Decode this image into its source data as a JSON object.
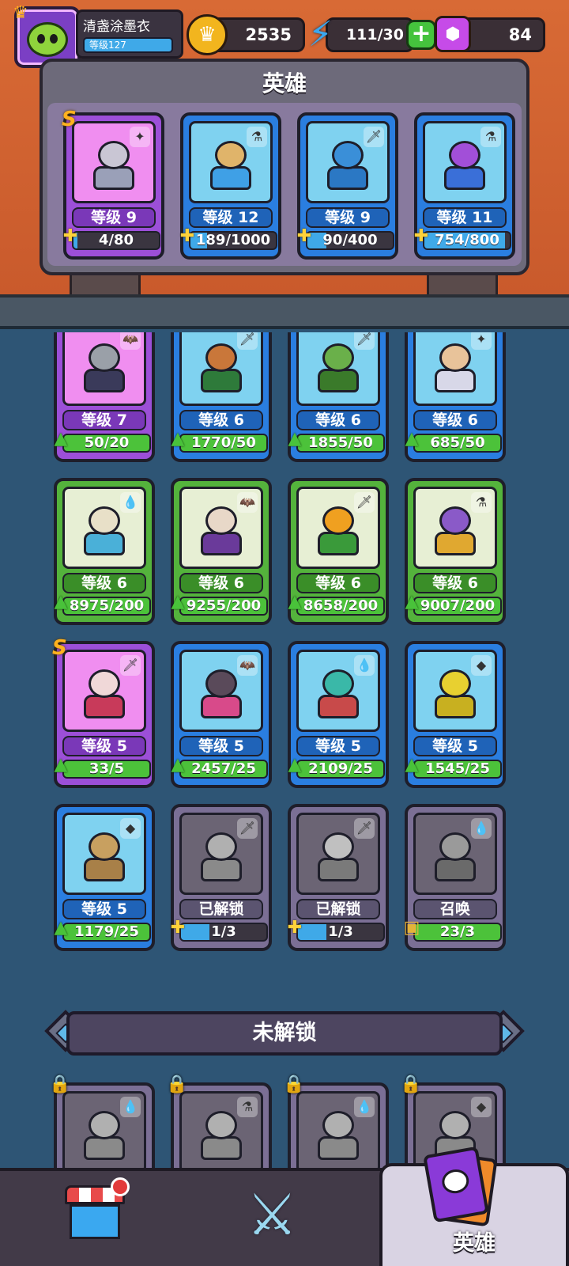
{
  "player": {
    "name": "清盏涂墨衣",
    "level_label": "等级127"
  },
  "resources": {
    "gold": "2535",
    "energy": "111/30",
    "gems": "84"
  },
  "owned_panel": {
    "title": "英雄",
    "cards": [
      {
        "color": "purple",
        "grade": "S",
        "elem": "✦",
        "level": "等级 9",
        "progress": "4/80",
        "fill": 0.05,
        "icon": "puzzle",
        "head": "#c9c6d4",
        "body": "#9aa0b8"
      },
      {
        "color": "blue",
        "grade": "",
        "elem": "⚗",
        "level": "等级 12",
        "progress": "189/1000",
        "fill": 0.19,
        "icon": "puzzle",
        "head": "#e0b46a",
        "body": "#3fa0e6"
      },
      {
        "color": "blue",
        "grade": "",
        "elem": "🗡",
        "level": "等级 9",
        "progress": "90/400",
        "fill": 0.22,
        "icon": "puzzle",
        "head": "#3a8fd8",
        "body": "#2b78c4"
      },
      {
        "color": "blue",
        "grade": "",
        "elem": "⚗",
        "level": "等级 11",
        "progress": "754/800",
        "fill": 0.94,
        "icon": "puzzle",
        "head": "#a24fd8",
        "body": "#3a6fd8"
      }
    ]
  },
  "grid_cards": [
    {
      "color": "purple",
      "grade": "",
      "elem": "🦇",
      "level": "等级 7",
      "progress": "50/20",
      "fill": 1,
      "icon": "arrow",
      "head": "#9aa0a8",
      "body": "#3a3a5a"
    },
    {
      "color": "blue",
      "grade": "",
      "elem": "🗡",
      "level": "等级 6",
      "progress": "1770/50",
      "fill": 1,
      "icon": "arrow",
      "head": "#c9773a",
      "body": "#2e7a3a"
    },
    {
      "color": "blue",
      "grade": "",
      "elem": "🗡",
      "level": "等级 6",
      "progress": "1855/50",
      "fill": 1,
      "icon": "arrow",
      "head": "#6ab04a",
      "body": "#3a7a2a"
    },
    {
      "color": "blue",
      "grade": "",
      "elem": "✦",
      "level": "等级 6",
      "progress": "685/50",
      "fill": 1,
      "icon": "arrow",
      "head": "#e8c39a",
      "body": "#d8d8e8"
    },
    {
      "color": "green",
      "grade": "",
      "elem": "💧",
      "level": "等级 6",
      "progress": "8975/200",
      "fill": 1,
      "icon": "arrow",
      "head": "#e8e0c8",
      "body": "#4ab0d8"
    },
    {
      "color": "green",
      "grade": "",
      "elem": "🦇",
      "level": "等级 6",
      "progress": "9255/200",
      "fill": 1,
      "icon": "arrow",
      "head": "#e8d8c8",
      "body": "#6a3a9a"
    },
    {
      "color": "green",
      "grade": "",
      "elem": "🗡",
      "level": "等级 6",
      "progress": "8658/200",
      "fill": 1,
      "icon": "arrow",
      "head": "#f0a020",
      "body": "#3a9a3a"
    },
    {
      "color": "green",
      "grade": "",
      "elem": "⚗",
      "level": "等级 6",
      "progress": "9007/200",
      "fill": 1,
      "icon": "arrow",
      "head": "#8a5ac8",
      "body": "#e0a830"
    },
    {
      "color": "purple",
      "grade": "S",
      "elem": "🗡",
      "level": "等级 5",
      "progress": "33/5",
      "fill": 1,
      "icon": "arrow",
      "head": "#f0d8d8",
      "body": "#c83a5a"
    },
    {
      "color": "blue",
      "grade": "",
      "elem": "🦇",
      "level": "等级 5",
      "progress": "2457/25",
      "fill": 1,
      "icon": "arrow",
      "head": "#5a4a5a",
      "body": "#d84a8a"
    },
    {
      "color": "blue",
      "grade": "",
      "elem": "💧",
      "level": "等级 5",
      "progress": "2109/25",
      "fill": 1,
      "icon": "arrow",
      "head": "#3ab8a8",
      "body": "#c84a4a"
    },
    {
      "color": "blue",
      "grade": "",
      "elem": "◆",
      "level": "等级 5",
      "progress": "1545/25",
      "fill": 1,
      "icon": "arrow",
      "head": "#e8d030",
      "body": "#c8b020"
    },
    {
      "color": "blue",
      "grade": "",
      "elem": "◆",
      "level": "等级 5",
      "progress": "1179/25",
      "fill": 1,
      "icon": "arrow",
      "head": "#c8a060",
      "body": "#a88048"
    },
    {
      "color": "grey",
      "grade": "",
      "elem": "🗡",
      "level": "已解锁",
      "progress": "1/3",
      "fill": 0.33,
      "icon": "puzzle",
      "head": "#b0b0b0",
      "body": "#8a8a8a"
    },
    {
      "color": "grey",
      "grade": "",
      "elem": "🗡",
      "level": "已解锁",
      "progress": "1/3",
      "fill": 0.33,
      "icon": "puzzle",
      "head": "#c0c0c0",
      "body": "#7a7a7a"
    },
    {
      "color": "grey",
      "grade": "",
      "elem": "💧",
      "level": "召唤",
      "progress": "23/3",
      "fill": 1,
      "icon": "scroll",
      "head": "#9a9a9a",
      "body": "#6a6a6a"
    }
  ],
  "locked_section": {
    "title": "未解锁",
    "cards": [
      {
        "elem": "💧"
      },
      {
        "elem": "⚗"
      },
      {
        "elem": "💧"
      },
      {
        "elem": "◆"
      }
    ]
  },
  "nav": {
    "shop_label": "",
    "battle_label": "",
    "heroes_label": "英雄"
  },
  "colors": {
    "accent_green": "#4cc23a",
    "accent_blue": "#3fa9e8",
    "bar_blue": "#3fa9e8",
    "bar_green": "#4cc23a"
  }
}
